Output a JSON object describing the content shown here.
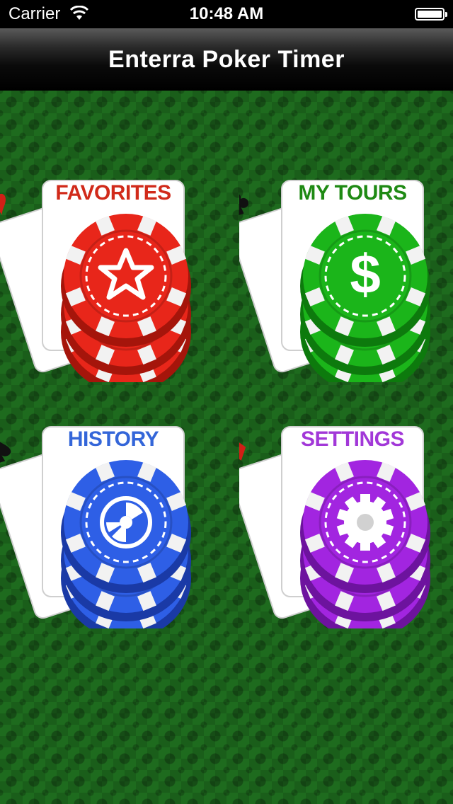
{
  "status_bar": {
    "carrier": "Carrier",
    "time": "10:48 AM"
  },
  "nav": {
    "title": "Enterra Poker Timer"
  },
  "menu": [
    {
      "label": "FAVORITES",
      "label_color": "#d12a1a",
      "chip_color": "#e8261a",
      "chip_dark": "#a5150b",
      "card_suit": "heart-icon",
      "icon": "star-icon"
    },
    {
      "label": "MY TOURS",
      "label_color": "#1f8a14",
      "chip_color": "#1bb51a",
      "chip_dark": "#0d7a0d",
      "card_suit": "club-icon",
      "icon": "dollar-icon"
    },
    {
      "label": "HISTORY",
      "label_color": "#3466d9",
      "chip_color": "#2e5fe6",
      "chip_dark": "#1a3aa6",
      "card_suit": "spade-icon",
      "icon": "disc-icon"
    },
    {
      "label": "SETTINGS",
      "label_color": "#a238d8",
      "chip_color": "#a225e0",
      "chip_dark": "#6d139e",
      "card_suit": "diamond-icon",
      "icon": "gear-icon"
    }
  ]
}
